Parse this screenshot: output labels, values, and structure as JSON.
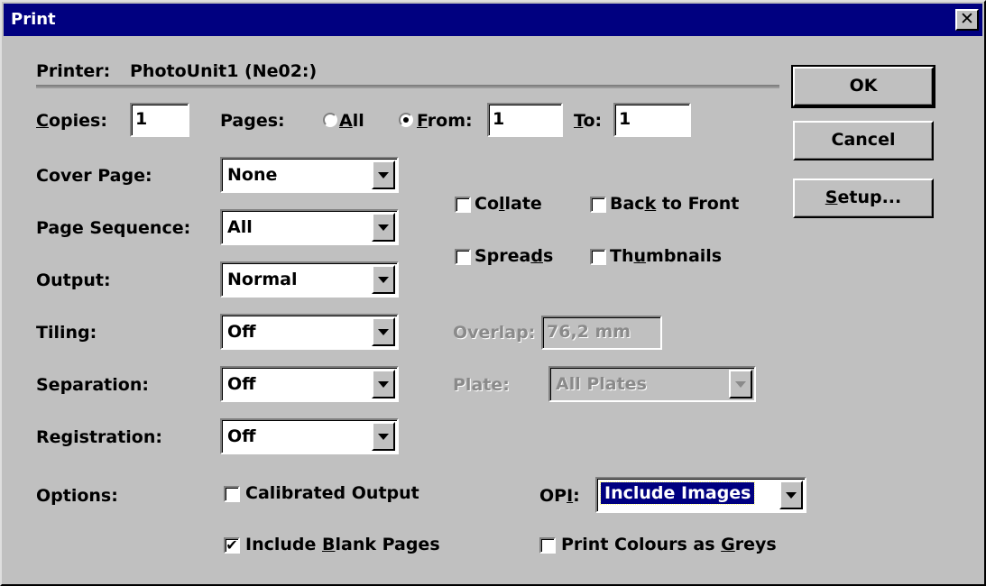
{
  "window": {
    "title": "Print",
    "close_symbol": "✕"
  },
  "printer": {
    "label": "Printer:",
    "name": "PhotoUnit1  (Ne02:)"
  },
  "copies": {
    "label_u": "C",
    "label_rest": "opies:",
    "value": "1"
  },
  "pages": {
    "label": "Pages:",
    "all_u": "A",
    "all_rest": "ll",
    "all_selected": false,
    "from_u": "F",
    "from_rest": "rom:",
    "from_selected": true,
    "from_value": "1",
    "to_u": "T",
    "to_rest": "o:",
    "to_value": "1"
  },
  "fields": {
    "cover_page": {
      "label": "Cover Page:",
      "value": "None"
    },
    "page_sequence": {
      "label": "Page Sequence:",
      "value": "All"
    },
    "output": {
      "label": "Output:",
      "value": "Normal"
    },
    "tiling": {
      "label": "Tiling:",
      "value": "Off"
    },
    "separation": {
      "label": "Separation:",
      "value": "Off"
    },
    "registration": {
      "label": "Registration:",
      "value": "Off"
    }
  },
  "checkboxes": {
    "collate": {
      "pre": "Co",
      "u": "l",
      "post": "late",
      "checked": false
    },
    "back_to_front": {
      "pre": "Bac",
      "u": "k",
      "post": " to Front",
      "checked": false
    },
    "spreads": {
      "pre": "Sprea",
      "u": "d",
      "post": "s",
      "checked": false
    },
    "thumbnails": {
      "pre": "Th",
      "u": "u",
      "post": "mbnails",
      "checked": false
    },
    "calibrated_output": {
      "label": "Calibrated Output",
      "checked": false
    },
    "include_blank": {
      "pre": "Include ",
      "u": "B",
      "post": "lank Pages",
      "checked": true
    },
    "print_colours": {
      "pre": "Print Colours as ",
      "u": "G",
      "post": "reys",
      "checked": false
    }
  },
  "overlap": {
    "label": "Overlap:",
    "value": "76,2 mm"
  },
  "plate": {
    "label": "Plate:",
    "value": "All Plates"
  },
  "options": {
    "label": "Options:"
  },
  "opi": {
    "pre": "OP",
    "u": "I",
    "post": ":",
    "value": "Include Images"
  },
  "buttons": {
    "ok": "OK",
    "cancel": "Cancel",
    "setup_u": "S",
    "setup_rest": "etup..."
  }
}
